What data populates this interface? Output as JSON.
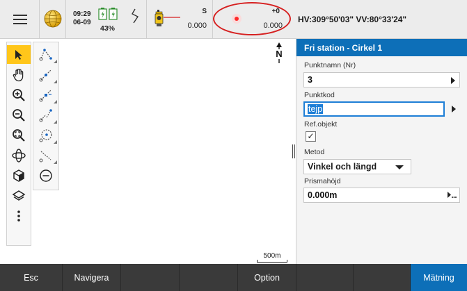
{
  "status_bar": {
    "time": "09:29",
    "date": "06-09",
    "battery_percent": "43%",
    "instrument": {
      "mode_label": "S",
      "value": "0.000"
    },
    "target": {
      "offset_label": "+0",
      "value": "0.000"
    },
    "hv_text": "HV:309°50'03\"  VV:80°33'24\""
  },
  "map": {
    "north_label": "N",
    "scale_label": "500m",
    "tools_col1": [
      "select-arrow-icon",
      "pan-hand-icon",
      "zoom-in-icon",
      "zoom-out-icon",
      "zoom-extents-icon",
      "orbit-icon",
      "cube-view-icon",
      "layers-icon",
      "more-vert-icon"
    ],
    "tools_col2": [
      "measure-points-icon",
      "line-icon",
      "point-on-line-icon",
      "offset-line-icon",
      "arc-icon",
      "split-line-icon",
      "minus-circle-icon"
    ]
  },
  "panel": {
    "title": "Fri station - Cirkel 1",
    "fields": {
      "punktnamn": {
        "label": "Punktnamn (Nr)",
        "value": "3"
      },
      "punktkod": {
        "label": "Punktkod",
        "value": "tejp"
      },
      "refobjekt": {
        "label": "Ref.objekt",
        "checked": true,
        "check_mark": "✓"
      },
      "metod": {
        "label": "Metod",
        "value": "Vinkel och längd"
      },
      "prismahojd": {
        "label": "Prismahöjd",
        "value": "0.000m"
      }
    }
  },
  "softkeys": [
    {
      "label": "Esc"
    },
    {
      "label": "Navigera"
    },
    {
      "label": ""
    },
    {
      "label": ""
    },
    {
      "label": "Option"
    },
    {
      "label": ""
    },
    {
      "label": ""
    },
    {
      "label": "Mätning"
    }
  ],
  "colors": {
    "accent_blue": "#0d6fb8",
    "selected_tool": "#ffc61a",
    "highlight_circle": "#d62020",
    "target_dot": "#ff2a2a"
  }
}
